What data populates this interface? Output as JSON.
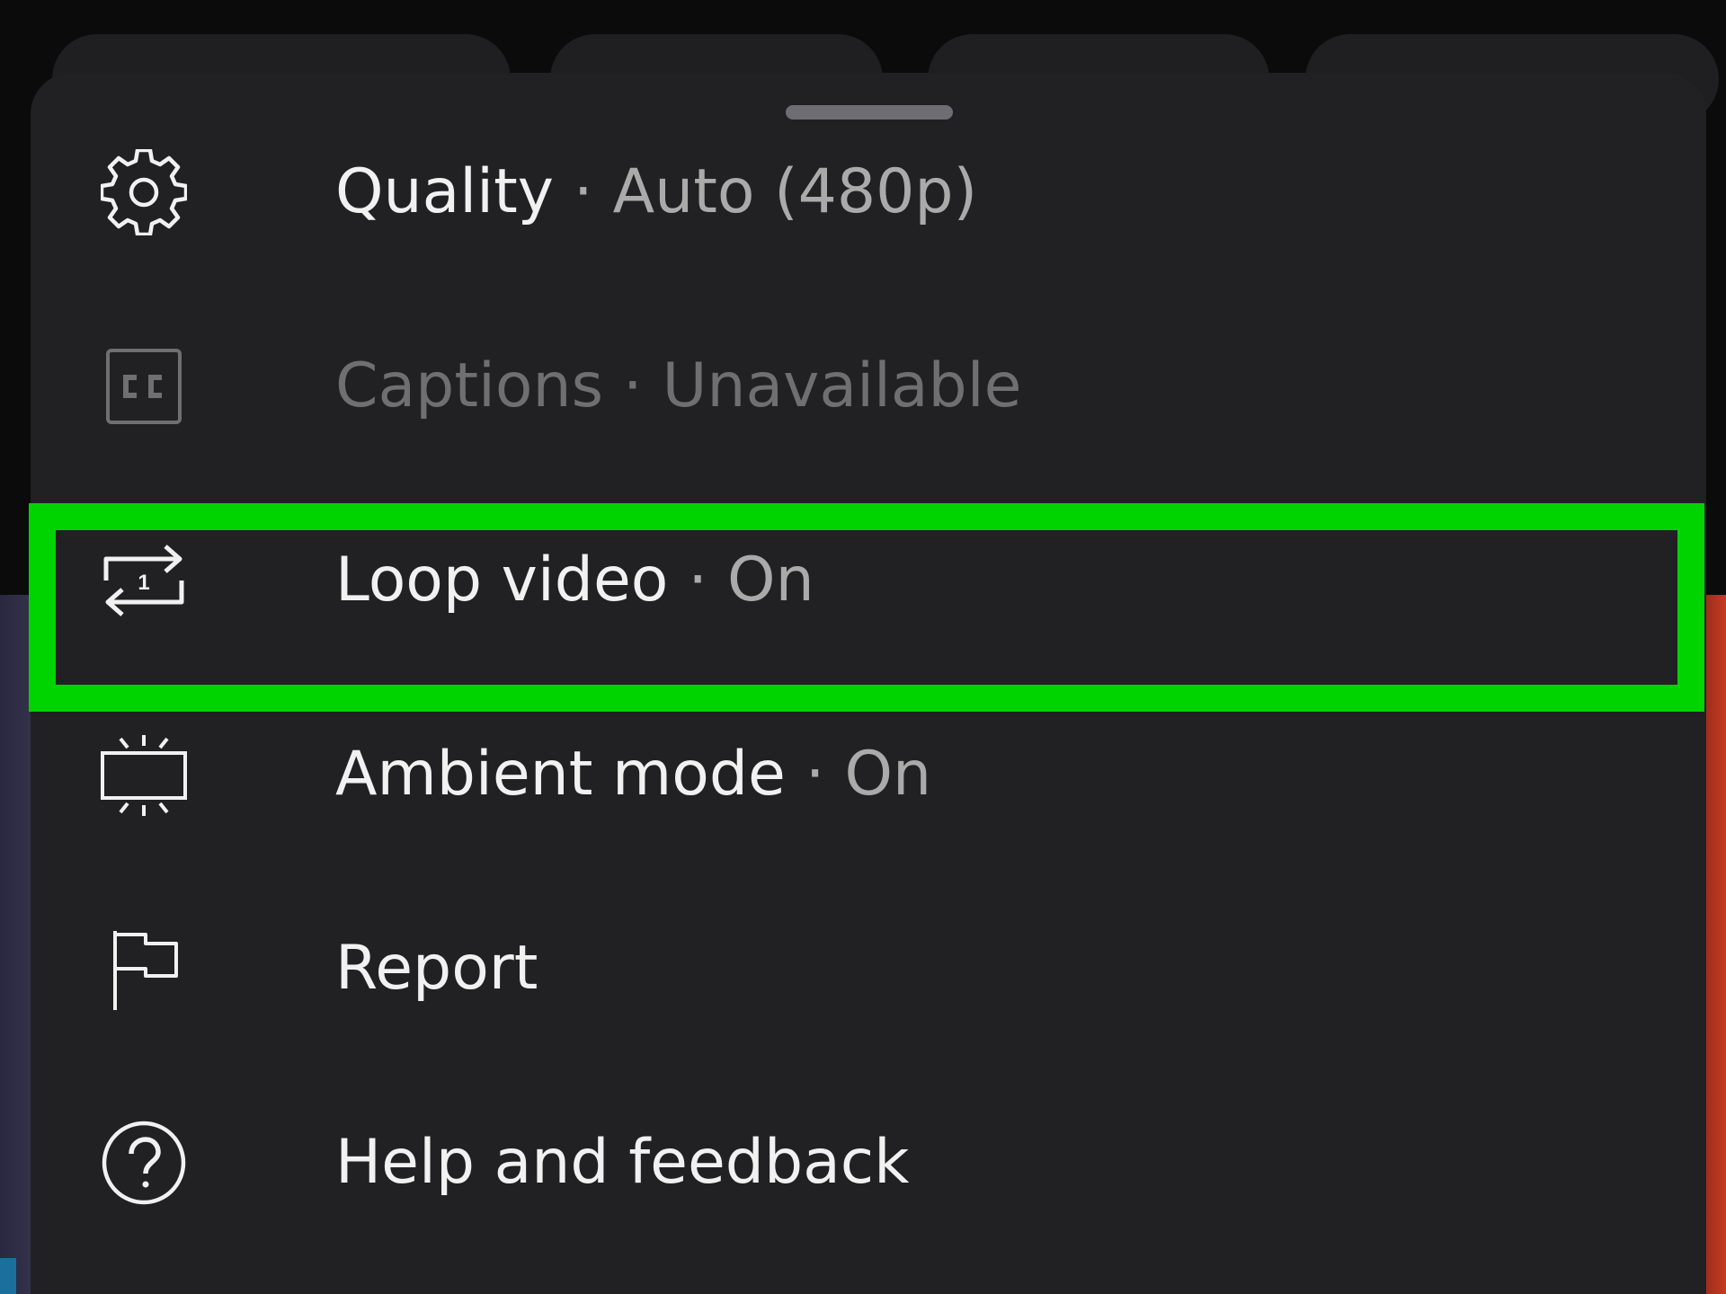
{
  "colors": {
    "sheet_background": "#212123",
    "primary_text": "#f1f1f1",
    "secondary_text": "#aaaaaa",
    "disabled_text": "#6f6f72",
    "highlight": "#00d400"
  },
  "menu": {
    "items": [
      {
        "label": "Quality",
        "separator": "·",
        "value": "Auto (480p)",
        "icon": "gear-icon",
        "enabled": true
      },
      {
        "label": "Captions",
        "separator": "·",
        "value": "Unavailable",
        "icon": "closed-captions-icon",
        "enabled": false
      },
      {
        "label": "Loop video",
        "separator": "·",
        "value": "On",
        "icon": "repeat-one-icon",
        "enabled": true,
        "highlighted": true
      },
      {
        "label": "Ambient mode",
        "separator": "·",
        "value": "On",
        "icon": "ambient-mode-icon",
        "enabled": true
      },
      {
        "label": "Report",
        "icon": "flag-icon",
        "enabled": true
      },
      {
        "label": "Help and feedback",
        "icon": "help-circle-icon",
        "enabled": true
      }
    ]
  }
}
